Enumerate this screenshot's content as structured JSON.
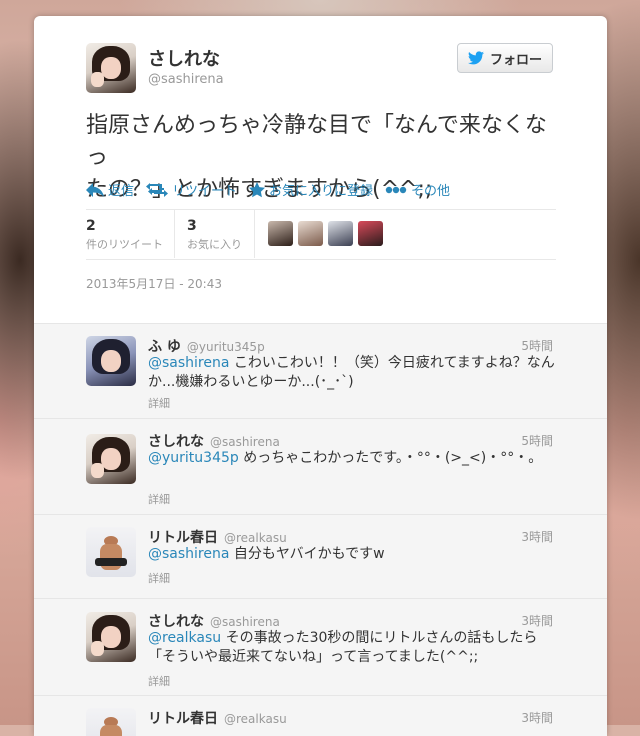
{
  "author": {
    "name": "さしれな",
    "handle": "@sashirena",
    "avatar": "photo-avatar"
  },
  "follow_button": {
    "label": "フォロー",
    "icon": "twitter-bird-icon",
    "icon_color": "#1da1f2"
  },
  "tweet": {
    "text_line1": "指原さんめっちゃ冷静な目で「なんで来なくなっ",
    "text_line2": "たの？」とか怖すぎますから(^^;;",
    "timestamp": "2013年5月17日 - 20:43"
  },
  "actions": [
    {
      "label": "返信",
      "icon": "reply-arrow-icon"
    },
    {
      "label": "リツイート",
      "icon": "retweet-icon"
    },
    {
      "label": "お気に入りに登録",
      "icon": "star-icon"
    },
    {
      "label": "その他",
      "icon": "more-dots-icon"
    }
  ],
  "stats": {
    "retweets": {
      "count": "2",
      "label": "件のリツイート"
    },
    "favorites": {
      "count": "3",
      "label": "お気に入り"
    }
  },
  "colors": {
    "link": "#2a87b9",
    "muted": "#999999",
    "reply_bg": "#f5f5f5"
  },
  "replies": [
    {
      "name": "ふ ゆ",
      "handle": "@yuritu345p",
      "time": "5時間",
      "mention": "@sashirena",
      "text": " こわいこわい！！（笑）今日疲れてますよね？なんか...機嫌わるいとゆーか...(･_･`)",
      "detail": "詳細"
    },
    {
      "name": "さしれな",
      "handle": "@sashirena",
      "time": "5時間",
      "mention": "@yuritu345p",
      "text": " めっちゃこわかったです。・°°・(>_<)・°°・。",
      "detail": "詳細"
    },
    {
      "name": "リトル春日",
      "handle": "@realkasu",
      "time": "3時間",
      "mention": "@sashirena",
      "text": " 自分もヤバイかもですw",
      "detail": "詳細"
    },
    {
      "name": "さしれな",
      "handle": "@sashirena",
      "time": "3時間",
      "mention": "@realkasu",
      "text": " その事故った30秒の間にリトルさんの話もしたら「そういや最近来てないね」って言ってました(^^;;",
      "detail": "詳細"
    },
    {
      "name": "リトル春日",
      "handle": "@realkasu",
      "time": "3時間"
    }
  ]
}
